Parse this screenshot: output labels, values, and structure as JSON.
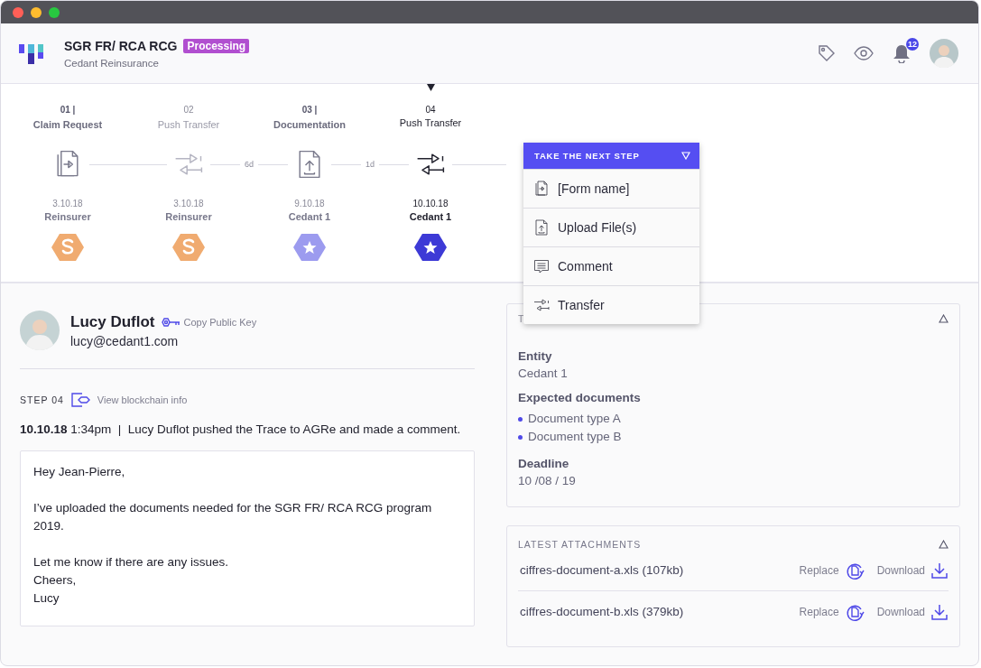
{
  "window": {
    "controls": [
      {
        "color": "#ff5f57"
      },
      {
        "color": "#febc2e"
      },
      {
        "color": "#28c840"
      }
    ]
  },
  "header": {
    "title": "SGR FR/ RCA RCG",
    "status": "Processing",
    "subtitle": "Cedant Reinsurance",
    "notification_count": "12"
  },
  "timeline": {
    "steps": [
      {
        "number": "01 |",
        "title": "Claim Request",
        "disabled": false,
        "selected": false,
        "kind": "form",
        "date": "3.10.18",
        "entity": "Reinsurer",
        "badge": {
          "kind": "reinsurer",
          "color": "#f0ab70"
        }
      },
      {
        "number": "02",
        "title": "Push Transfer",
        "disabled": true,
        "selected": false,
        "kind": "transfer",
        "date": "3.10.18",
        "entity": "Reinsurer",
        "badge": {
          "kind": "reinsurer",
          "color": "#f0ab70"
        }
      },
      {
        "number": "03 |",
        "title": "Documentation",
        "disabled": false,
        "selected": false,
        "kind": "upload",
        "gap_before": "6d",
        "date": "9.10.18",
        "entity": "Cedant 1",
        "badge": {
          "kind": "cedant",
          "color": "#9c9bef"
        }
      },
      {
        "number": "04",
        "title": "Push Transfer",
        "disabled": false,
        "selected": true,
        "kind": "transfer",
        "gap_before": "1d",
        "date": "10.10.18",
        "entity": "Cedant 1",
        "badge": {
          "kind": "cedant",
          "color": "#3d3ad6"
        }
      }
    ]
  },
  "next_step_menu": {
    "title": "TAKE THE NEXT STEP",
    "items": [
      {
        "label": "[Form name]",
        "kind": "form"
      },
      {
        "label": "Upload File(s)",
        "kind": "upload"
      },
      {
        "label": "Comment",
        "kind": "comment"
      },
      {
        "label": "Transfer",
        "kind": "transfer"
      }
    ]
  },
  "comment": {
    "author": {
      "name": "Lucy Duflot",
      "key_link": "Copy Public Key",
      "email": "lucy@cedant1.com"
    },
    "step_label": "STEP 04",
    "blockchain_link": "View blockchain info",
    "summary": "**10.10.18** 1:34pm  |  Lucy Duflot pushed the Trace to AGRe and made a comment.",
    "message": [
      "Hey Jean-Pierre,",
      "I’ve uploaded the documents needed for the SGR FR/ RCA RCG program 2019.",
      "Let me know if there are any issues.\nCheers,\nLucy"
    ]
  },
  "details": {
    "title": "T",
    "fields": [
      {
        "kind": "text",
        "label": "Entity",
        "value": "Cedant 1"
      },
      {
        "kind": "list",
        "label": "Expected documents",
        "items": [
          "Document type A",
          "Document type B"
        ]
      },
      {
        "kind": "text",
        "label": "Deadline",
        "value": "10 /08 / 19"
      }
    ]
  },
  "attachments": {
    "title": "LATEST ATTACHMENTS",
    "files": [
      {
        "name": "ciffres-document-a.xls (107kb)",
        "replace": "Replace",
        "download": "Download"
      },
      {
        "name": "ciffres-document-b.xls (379kb)",
        "replace": "Replace",
        "download": "Download"
      }
    ]
  }
}
